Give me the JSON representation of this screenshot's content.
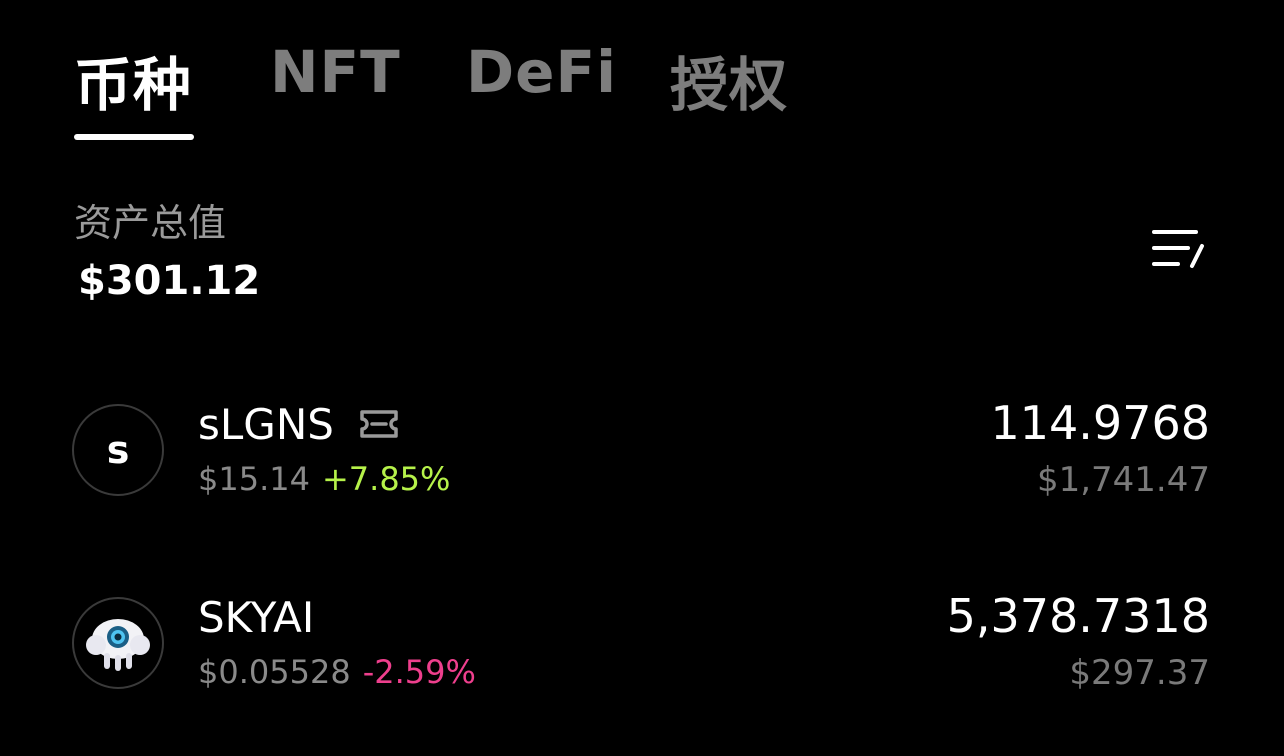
{
  "tabs": [
    {
      "label": "币种",
      "active": true
    },
    {
      "label": "NFT",
      "active": false
    },
    {
      "label": "DeFi",
      "active": false
    },
    {
      "label": "授权",
      "active": false
    }
  ],
  "summary": {
    "label": "资产总值",
    "value": "$301.12",
    "filter_icon": "filter-list-icon"
  },
  "assets": [
    {
      "avatar_letter": "s",
      "name": "sLGNS",
      "badge_icon": "ticket-icon",
      "price": "$15.14",
      "change": "+7.85%",
      "amount": "114.9768",
      "fiat_value": "$1,741.47"
    },
    {
      "avatar_icon": "jellyfish-logo-icon",
      "name": "SKYAI",
      "price": "$0.05528",
      "change": "-2.59%",
      "amount": "5,378.7318",
      "fiat_value": "$297.37"
    }
  ],
  "colors": {
    "background": "#000000",
    "positive": "#b6f24a",
    "negative": "#ee3f8d",
    "muted": "#8a8a8a"
  }
}
